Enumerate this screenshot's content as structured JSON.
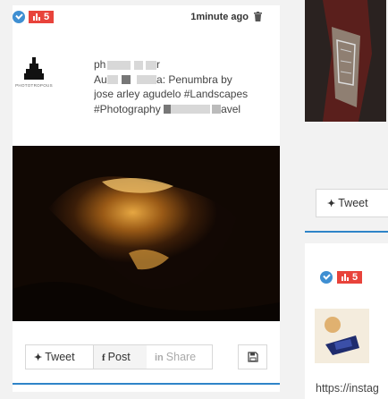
{
  "post": {
    "badge_count": "5",
    "time": "1minute ago",
    "avatar_caption": "PHOTOTROPOUS",
    "lines": {
      "l1_start": "ph",
      "l1_end": "r",
      "l2_start": "Au",
      "l2_end": "a: Penumbra by",
      "l3": "jose arley agudelo #Landscapes",
      "l4_start": "#Photography",
      "l4_end": "avel"
    },
    "share": {
      "tweet_label": "Tweet",
      "post_label": "Post",
      "share_label": "Share"
    }
  },
  "side": {
    "tweet_label": "Tweet",
    "badge_count": "5",
    "link_text": "https://instag"
  },
  "colors": {
    "accent_blue": "#2f84c8",
    "badge_red": "#e8433b",
    "check_blue": "#3f8fd2"
  },
  "icons": [
    "check-circle-icon",
    "badge-icon",
    "trash-icon",
    "twitter-icon",
    "facebook-icon",
    "linkedin-icon",
    "save-icon"
  ]
}
